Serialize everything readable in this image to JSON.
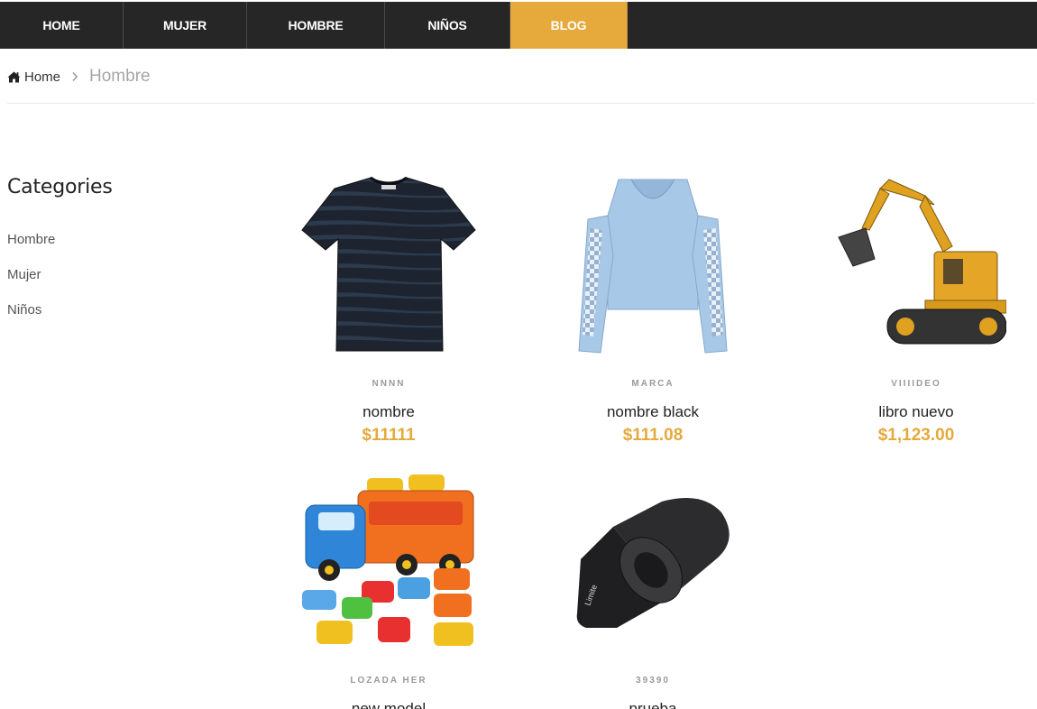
{
  "nav": {
    "items": [
      {
        "label": "HOME"
      },
      {
        "label": "MUJER"
      },
      {
        "label": "HOMBRE"
      },
      {
        "label": "NIÑOS"
      },
      {
        "label": "BLOG"
      }
    ],
    "active_color": "#e5a93c",
    "bar_color": "#262626"
  },
  "breadcrumb": {
    "home_label": "Home",
    "home_icon": "home-icon",
    "separator_icon": "chevron-right-icon",
    "current": "Hombre"
  },
  "sidebar": {
    "title": "Categories",
    "items": [
      {
        "label": "Hombre"
      },
      {
        "label": "Mujer"
      },
      {
        "label": "Niños"
      }
    ]
  },
  "products": [
    {
      "brand": "NNNN",
      "name": "nombre",
      "price": "$11111",
      "image": "black-tshirt"
    },
    {
      "brand": "MARCA",
      "name": "nombre black",
      "price": "$111.08",
      "image": "blue-hoodie"
    },
    {
      "brand": "VIIIIDEO",
      "name": "libro nuevo",
      "price": "$1,123.00",
      "image": "toy-excavator"
    },
    {
      "brand": "LOZADA HER",
      "name": "new model",
      "price": "",
      "image": "toy-car-carrier"
    },
    {
      "brand": "39390",
      "name": "prueba",
      "price": "",
      "image": "yoga-mat"
    }
  ],
  "colors": {
    "accent": "#e5a93c"
  }
}
